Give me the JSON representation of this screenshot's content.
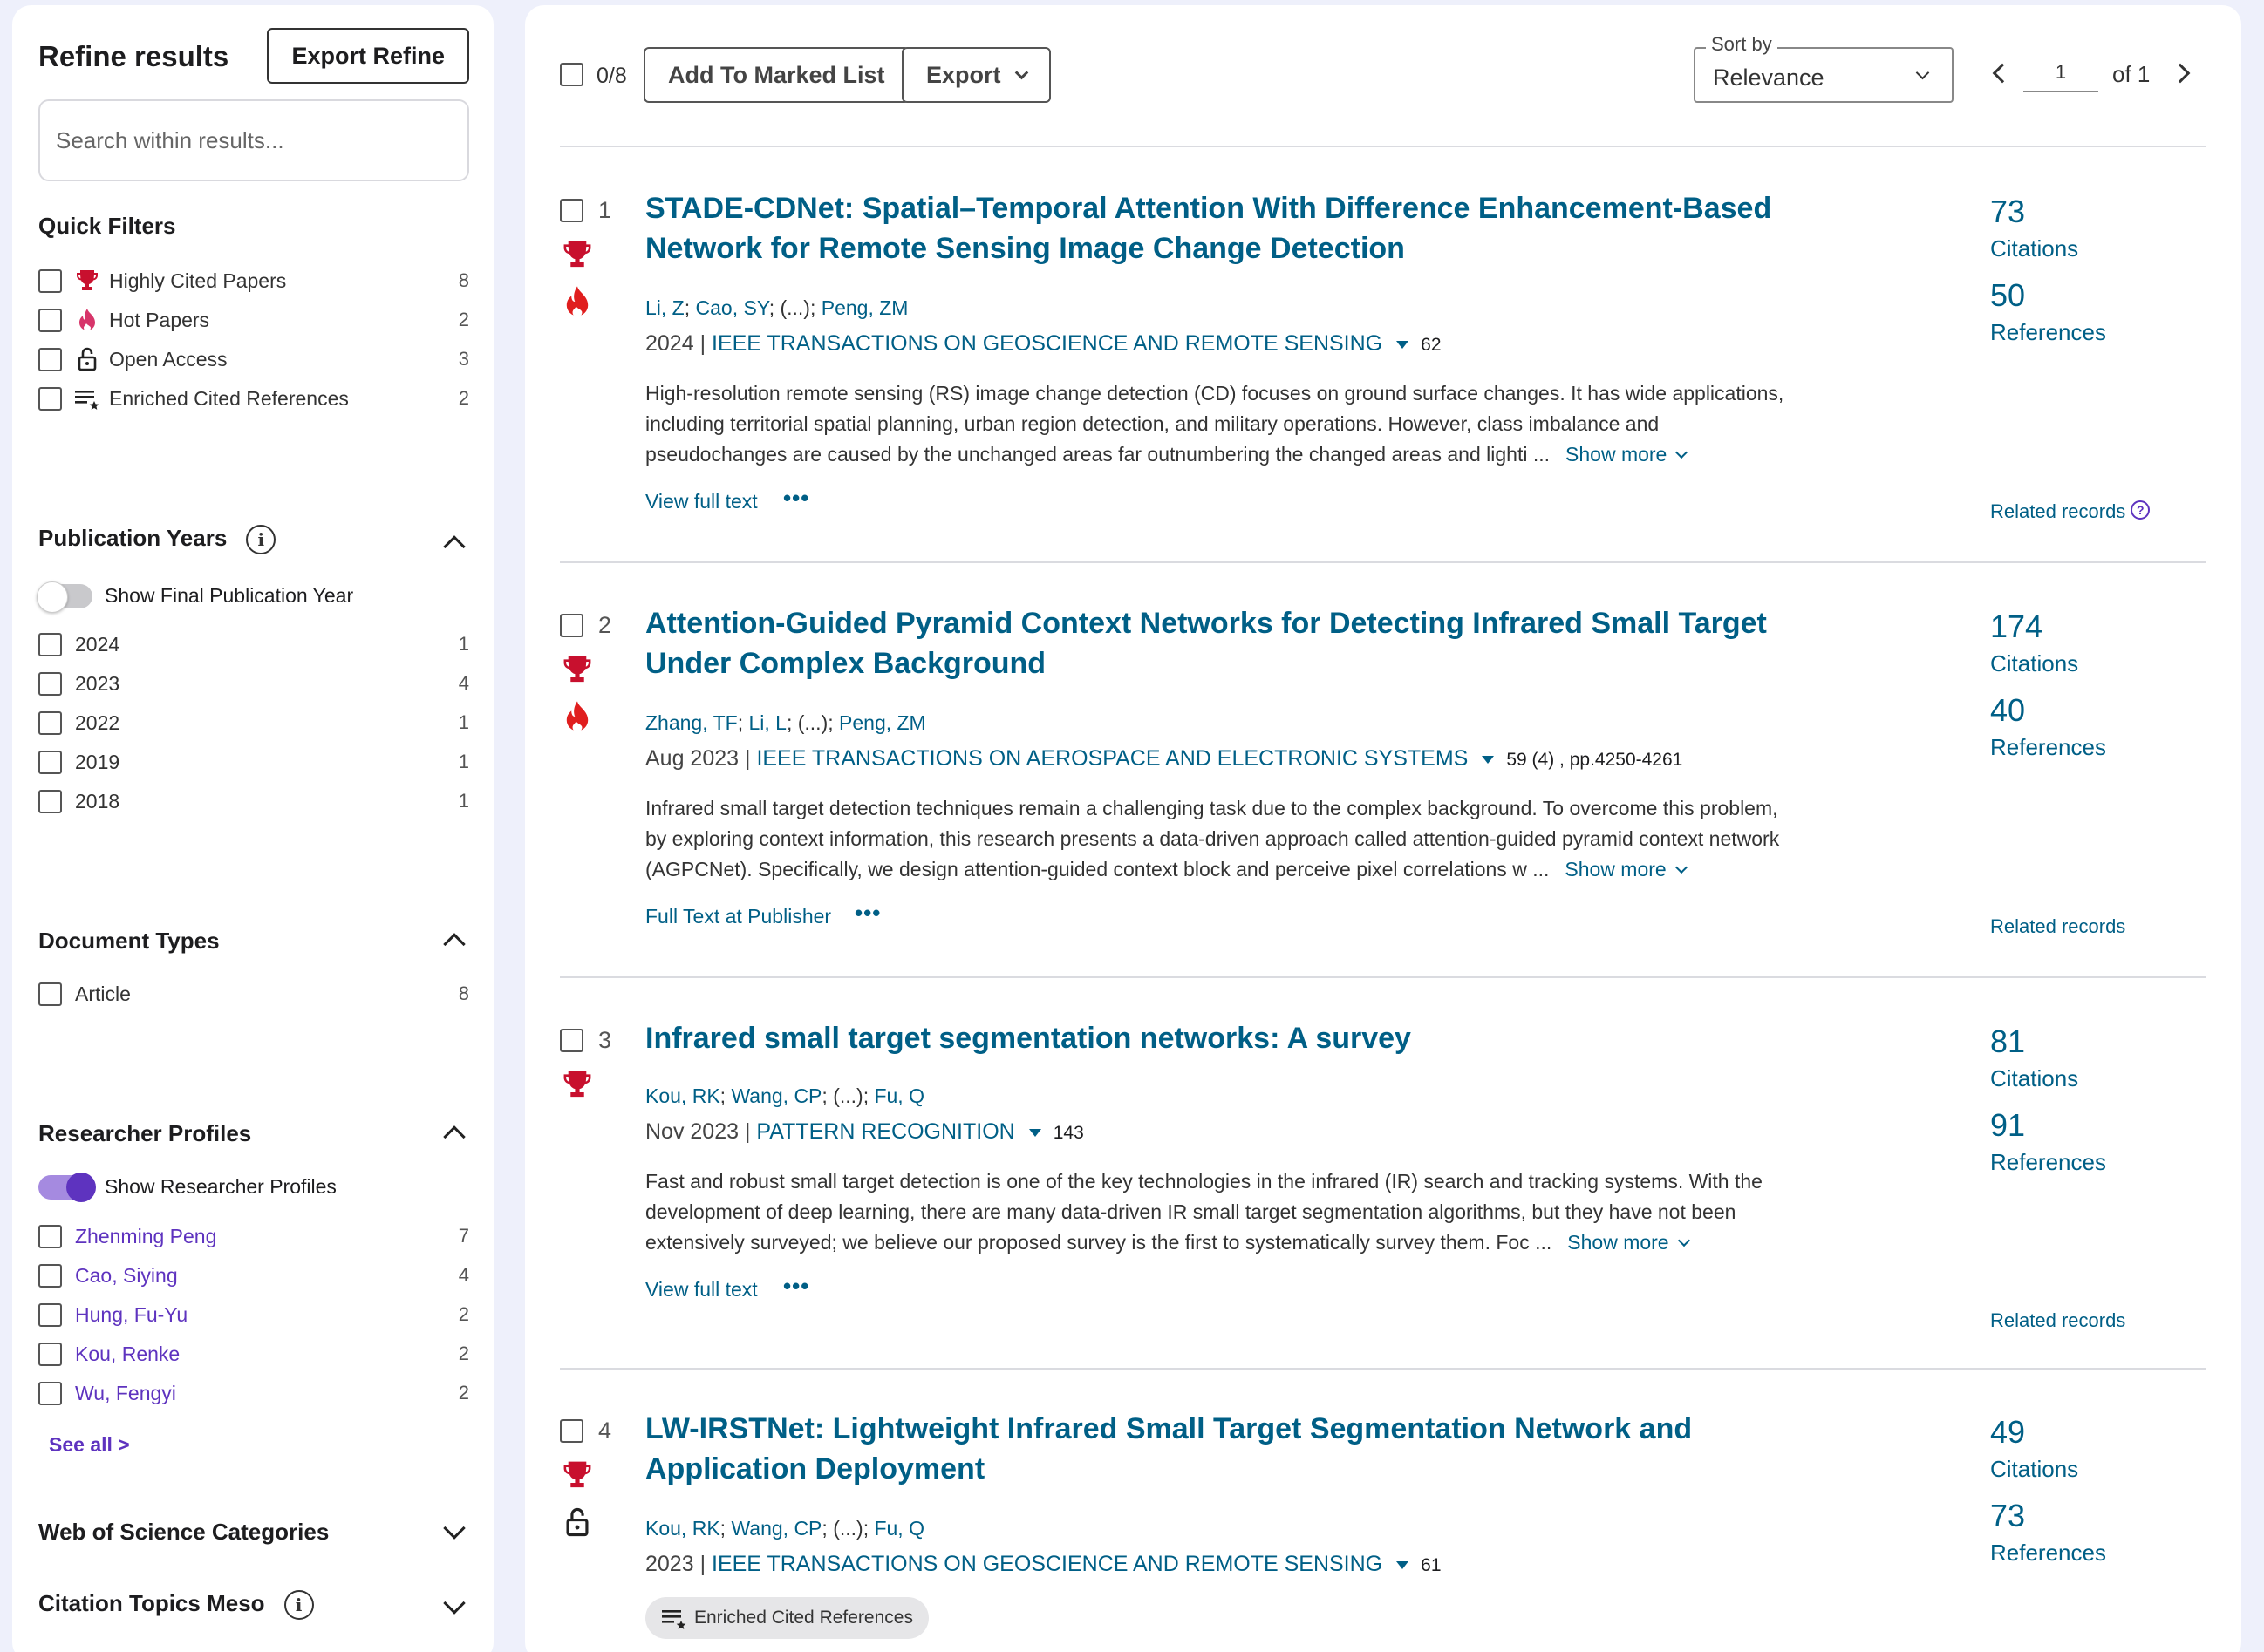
{
  "sidebar": {
    "title": "Refine results",
    "export_label": "Export Refine",
    "search_placeholder": "Search within results...",
    "quick_filters": {
      "title": "Quick Filters",
      "items": [
        {
          "label": "Highly Cited Papers",
          "count": "8",
          "icon": "trophy-icon"
        },
        {
          "label": "Hot Papers",
          "count": "2",
          "icon": "flame-icon"
        },
        {
          "label": "Open Access",
          "count": "3",
          "icon": "lock-open-icon"
        },
        {
          "label": "Enriched Cited References",
          "count": "2",
          "icon": "enriched-references-icon"
        }
      ]
    },
    "publication_years": {
      "title": "Publication Years",
      "toggle_label": "Show Final Publication Year",
      "items": [
        {
          "label": "2024",
          "count": "1"
        },
        {
          "label": "2023",
          "count": "4"
        },
        {
          "label": "2022",
          "count": "1"
        },
        {
          "label": "2019",
          "count": "1"
        },
        {
          "label": "2018",
          "count": "1"
        }
      ]
    },
    "document_types": {
      "title": "Document Types",
      "items": [
        {
          "label": "Article",
          "count": "8"
        }
      ]
    },
    "researcher_profiles": {
      "title": "Researcher Profiles",
      "toggle_label": "Show Researcher Profiles",
      "items": [
        {
          "label": "Zhenming Peng",
          "count": "7"
        },
        {
          "label": "Cao, Siying",
          "count": "4"
        },
        {
          "label": "Hung, Fu-Yu",
          "count": "2"
        },
        {
          "label": "Kou, Renke",
          "count": "2"
        },
        {
          "label": "Wu, Fengyi",
          "count": "2"
        }
      ],
      "see_all": "See all >"
    },
    "wos_categories": {
      "title": "Web of Science Categories"
    },
    "citation_topics": {
      "title": "Citation Topics Meso"
    }
  },
  "toolbar": {
    "selected_count": "0/8",
    "add_marked_label": "Add To Marked List",
    "export_label": "Export",
    "sort_label": "Sort by",
    "sort_value": "Relevance",
    "page_value": "1",
    "page_of": "of 1"
  },
  "records": [
    {
      "num": "1",
      "title": "STADE-CDNet: Spatial–Temporal Attention With Difference Enhancement-Based Network for Remote Sensing Image Change Detection",
      "authors": [
        "Li, Z",
        "Cao, SY",
        "(...)",
        "Peng, ZM"
      ],
      "date": "2024",
      "journal": "IEEE TRANSACTIONS ON GEOSCIENCE AND REMOTE SENSING",
      "volume": "62",
      "abstract": "High-resolution remote sensing (RS) image change detection (CD) focuses on ground surface changes. It has wide applications, including territorial spatial planning, urban region detection, and military operations. However, class imbalance and pseudochanges are caused by the unchanged areas far outnumbering the changed areas and lighti ...",
      "show_more": "Show more",
      "link_label": "View full text",
      "citations": "73",
      "citations_label": "Citations",
      "references": "50",
      "references_label": "References",
      "related": "Related records",
      "badges": [
        "trophy-icon",
        "flame-icon"
      ]
    },
    {
      "num": "2",
      "title": "Attention-Guided Pyramid Context Networks for Detecting Infrared Small Target Under Complex Background",
      "authors": [
        "Zhang, TF",
        "Li, L",
        "(...)",
        "Peng, ZM"
      ],
      "date": "Aug 2023",
      "journal": "IEEE TRANSACTIONS ON AEROSPACE AND ELECTRONIC SYSTEMS",
      "volume": "59 (4) , pp.4250-4261",
      "abstract": "Infrared small target detection techniques remain a challenging task due to the complex background. To overcome this problem, by exploring context information, this research presents a data-driven approach called attention-guided pyramid context network (AGPCNet). Specifically, we design attention-guided context block and perceive pixel correlations w ...",
      "show_more": "Show more",
      "link_label": "Full Text at Publisher",
      "citations": "174",
      "citations_label": "Citations",
      "references": "40",
      "references_label": "References",
      "related": "Related records",
      "badges": [
        "trophy-icon",
        "flame-icon"
      ]
    },
    {
      "num": "3",
      "title": "Infrared small target segmentation networks: A survey",
      "authors": [
        "Kou, RK",
        "Wang, CP",
        "(...)",
        "Fu, Q"
      ],
      "date": "Nov 2023",
      "journal": "PATTERN RECOGNITION",
      "volume": "143",
      "abstract": "Fast and robust small target detection is one of the key technologies in the infrared (IR) search and tracking systems. With the development of deep learning, there are many data-driven IR small target segmentation algorithms, but they have not been extensively surveyed; we believe our proposed survey is the first to systematically survey them. Foc ...",
      "show_more": "Show more",
      "link_label": "View full text",
      "citations": "81",
      "citations_label": "Citations",
      "references": "91",
      "references_label": "References",
      "related": "Related records",
      "badges": [
        "trophy-icon"
      ]
    },
    {
      "num": "4",
      "title": "LW-IRSTNet: Lightweight Infrared Small Target Segmentation Network and Application Deployment",
      "authors": [
        "Kou, RK",
        "Wang, CP",
        "(...)",
        "Fu, Q"
      ],
      "date": "2023",
      "journal": "IEEE TRANSACTIONS ON GEOSCIENCE AND REMOTE SENSING",
      "volume": "61",
      "pill": "Enriched Cited References",
      "citations": "49",
      "citations_label": "Citations",
      "references": "73",
      "references_label": "References",
      "badges": [
        "trophy-icon",
        "lock-open-icon"
      ]
    }
  ],
  "colors": {
    "link": "#005f86",
    "accent": "#5e33bf",
    "award": "#c8102e",
    "background": "#eef0fb"
  }
}
